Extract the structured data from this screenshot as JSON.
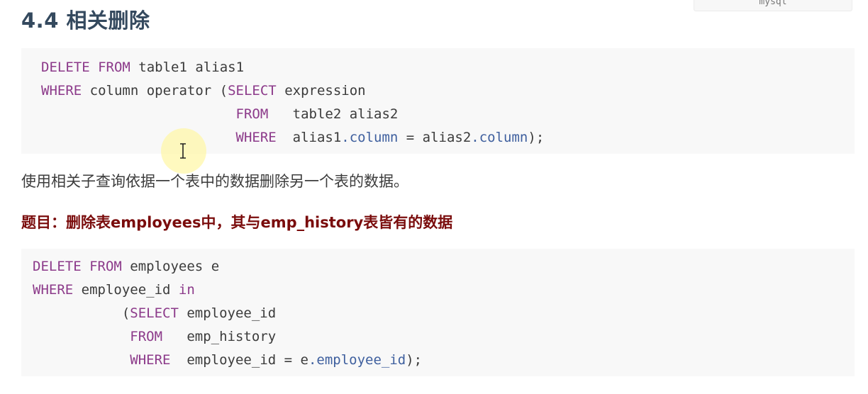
{
  "lang_label": "mysql",
  "heading": "4.4 相关删除",
  "code1": {
    "line1": [
      {
        "t": "DELETE",
        "k": "kw"
      },
      {
        "t": " ",
        "k": "plain"
      },
      {
        "t": "FROM",
        "k": "kw"
      },
      {
        "t": " table1 alias1",
        "k": "plain"
      }
    ],
    "line2": [
      {
        "t": "WHERE",
        "k": "kw"
      },
      {
        "t": " column operator (",
        "k": "plain"
      },
      {
        "t": "SELECT",
        "k": "kw"
      },
      {
        "t": " expression",
        "k": "plain"
      }
    ],
    "line3": [
      {
        "t": "                        ",
        "k": "plain"
      },
      {
        "t": "FROM",
        "k": "kw"
      },
      {
        "t": "   table2 alias2",
        "k": "plain"
      }
    ],
    "line4": [
      {
        "t": "                        ",
        "k": "plain"
      },
      {
        "t": "WHERE",
        "k": "kw"
      },
      {
        "t": "  alias1",
        "k": "plain"
      },
      {
        "t": ".column",
        "k": "prop"
      },
      {
        "t": " = alias2",
        "k": "plain"
      },
      {
        "t": ".column",
        "k": "prop"
      },
      {
        "t": ");",
        "k": "plain"
      }
    ]
  },
  "paragraph": "使用相关子查询依据一个表中的数据删除另一个表的数据。",
  "task": "题目：删除表employees中，其与emp_history表皆有的数据",
  "code2": {
    "line1": [
      {
        "t": "DELETE",
        "k": "kw"
      },
      {
        "t": " ",
        "k": "plain"
      },
      {
        "t": "FROM",
        "k": "kw"
      },
      {
        "t": " employees e",
        "k": "plain"
      }
    ],
    "line2": [
      {
        "t": "WHERE",
        "k": "kw"
      },
      {
        "t": " employee_id ",
        "k": "plain"
      },
      {
        "t": "in",
        "k": "kw"
      }
    ],
    "line3": [
      {
        "t": "           (",
        "k": "plain"
      },
      {
        "t": "SELECT",
        "k": "kw"
      },
      {
        "t": " employee_id",
        "k": "plain"
      }
    ],
    "line4": [
      {
        "t": "            ",
        "k": "plain"
      },
      {
        "t": "FROM",
        "k": "kw"
      },
      {
        "t": "   emp_history",
        "k": "plain"
      }
    ],
    "line5": [
      {
        "t": "            ",
        "k": "plain"
      },
      {
        "t": "WHERE",
        "k": "kw"
      },
      {
        "t": "  employee_id = e",
        "k": "plain"
      },
      {
        "t": ".employee_id",
        "k": "prop"
      },
      {
        "t": ");",
        "k": "plain"
      }
    ]
  },
  "colors": {
    "keyword": "#8c3a8a",
    "property": "#3e5f9e",
    "heading": "#34495e",
    "task": "#7a0c0c",
    "code_bg": "#f8f8f8"
  },
  "icons": {
    "cursor": "text-cursor-icon"
  }
}
